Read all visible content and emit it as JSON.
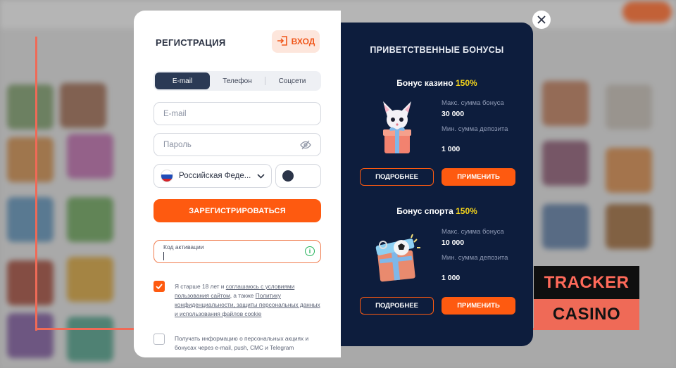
{
  "registration": {
    "title": "РЕГИСТРАЦИЯ",
    "login_label": "ВХОД",
    "tabs": [
      {
        "label": "E-mail",
        "active": true
      },
      {
        "label": "Телефон",
        "active": false
      },
      {
        "label": "Соцсети",
        "active": false
      }
    ],
    "email_placeholder": "E-mail",
    "password_placeholder": "Пароль",
    "country_value": "Российская Феде...",
    "register_label": "ЗАРЕГИСТРИРОВАТЬСЯ",
    "promo_label": "Код активации",
    "consent": {
      "checked": true,
      "text_1": "Я старше 18 лет и ",
      "link_1": "соглашаюсь с условиями пользования сайтом",
      "text_2": ", а также ",
      "link_2": "Политику конфиденциальности, защиты персональных данных и использования файлов cookie"
    },
    "newsletter": {
      "checked": false,
      "text": "Получать информацию о персональных акциях и бонусах через e-mail, push, СМС и Telegram"
    }
  },
  "bonuses": {
    "title": "ПРИВЕТСТВЕННЫЕ БОНУСЫ",
    "casino": {
      "name": "Бонус казино",
      "percent": "150%",
      "max_label": "Макс. сумма бонуса",
      "max_value": "30 000",
      "min_label": "Мин. сумма депозита",
      "min_value": "1 000",
      "more_label": "ПОДРОБНЕЕ",
      "apply_label": "ПРИМЕНИТЬ"
    },
    "sport": {
      "name": "Бонус спорта",
      "percent": "150%",
      "max_label": "Макс. сумма бонуса",
      "max_value": "10 000",
      "min_label": "Мин. сумма депозита",
      "min_value": "1 000",
      "more_label": "ПОДРОБНЕЕ",
      "apply_label": "ПРИМЕНИТЬ"
    }
  },
  "watermark": {
    "line1": "TRACKER",
    "line2": "CASINO"
  },
  "colors": {
    "accent": "#fe5a10",
    "dark_panel": "#0d1d3d",
    "highlight": "#f2d21b",
    "frame": "#ef6a57"
  }
}
